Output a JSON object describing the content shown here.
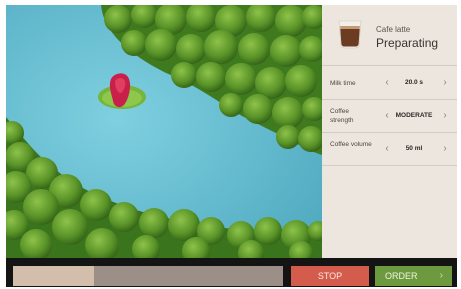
{
  "drink": {
    "name": "Cafe latte",
    "status": "Preparating"
  },
  "settings": [
    {
      "label": "Milk time",
      "value": "20.0 s"
    },
    {
      "label": "Coffee strength",
      "value": "MODERATE"
    },
    {
      "label": "Coffee volume",
      "value": "50 ml"
    }
  ],
  "icons": {
    "prev": "‹",
    "next": "›",
    "order_arrow": "›"
  },
  "progress": {
    "fraction": 0.3
  },
  "buttons": {
    "stop": "STOP",
    "order": "ORDER"
  },
  "colors": {
    "panel": "#ece6df",
    "stop": "#d45c4c",
    "order": "#6e9a3f",
    "progress_fill": "#d3bdab",
    "progress_track": "#9c8f87",
    "river": "#69c3d6"
  }
}
